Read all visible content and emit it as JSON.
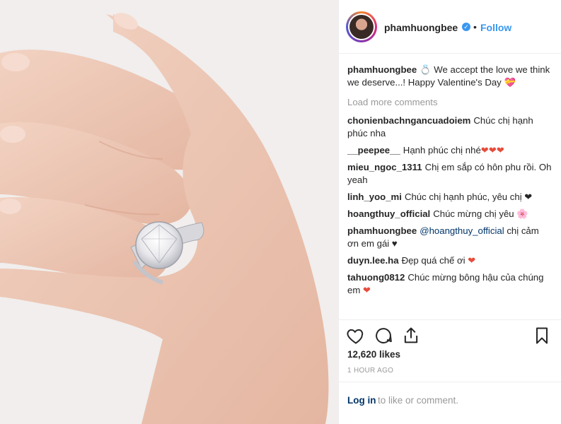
{
  "post": {
    "username": "phamhuongbee",
    "follow_label": "Follow",
    "separator": "•",
    "caption_user": "phamhuongbee",
    "caption_text": " We accept the love we think we deserve...! Happy Valentine's Day",
    "load_more": "Load more comments",
    "likes": "12,620 likes",
    "time": "1 HOUR AGO",
    "login_link": "Log in",
    "login_rest": "to like or comment."
  },
  "comments": [
    {
      "user": "chonienbachngancuadoiem",
      "text": "Chúc chị hạnh phúc nha"
    },
    {
      "user": "__peepee__",
      "text": "Hạnh phúc chị nhé",
      "suffix": "❤❤❤"
    },
    {
      "user": "mieu_ngoc_1311",
      "text": "Chị em sắp có hôn phu rồi. Oh yeah"
    },
    {
      "user": "linh_yoo_mi",
      "text": "Chúc chị hạnh phúc, yêu chị ❤"
    },
    {
      "user": "hoangthuy_official",
      "text": "Chúc mừng chị yêu 🌸"
    },
    {
      "user": "phamhuongbee",
      "mention": "@hoangthuy_official",
      "text": " chị cảm ơn em gái ♥"
    },
    {
      "user": "duyn.lee.ha",
      "text": "Đẹp quá chế ơi",
      "suffix": "❤"
    },
    {
      "user": "tahuong0812",
      "text": "Chúc mừng bông hậu của chúng em",
      "suffix": "❤"
    }
  ],
  "icons": {
    "heart": "heart-icon",
    "comment": "comment-icon",
    "share": "share-icon",
    "bookmark": "bookmark-icon",
    "verified": "verified-badge-icon"
  },
  "colors": {
    "accent": "#3897f0",
    "link": "#003569",
    "muted": "#999999",
    "heart": "#e74c3c"
  }
}
